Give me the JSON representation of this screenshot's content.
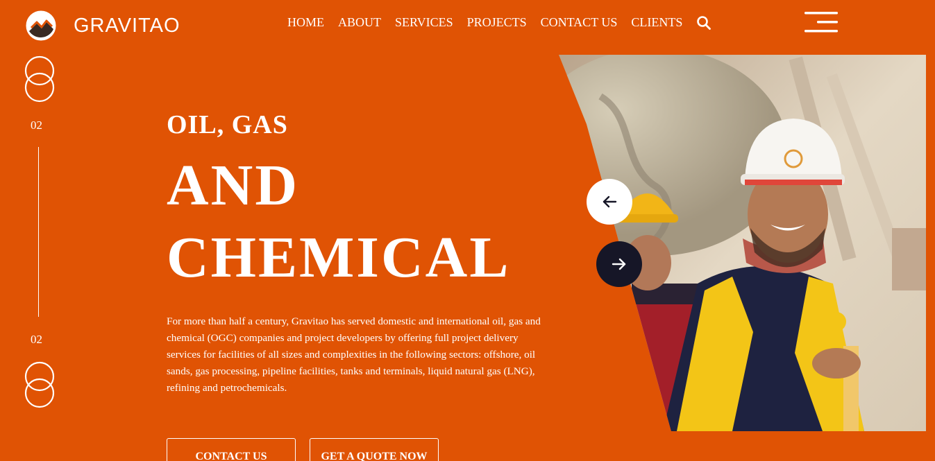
{
  "brand": {
    "name": "GRAVITAO",
    "logo_icon": "mountain-circle-logo-icon"
  },
  "nav": {
    "items": [
      {
        "label": "HOME"
      },
      {
        "label": "ABOUT"
      },
      {
        "label": "SERVICES"
      },
      {
        "label": "PROJECTS"
      },
      {
        "label": "CONTACT US"
      },
      {
        "label": "CLIENTS"
      }
    ],
    "search_icon": "search-icon",
    "menu_icon": "hamburger-menu-icon"
  },
  "slider": {
    "current": "02",
    "total": "02"
  },
  "hero": {
    "kicker": "OIL, GAS",
    "line1": "AND",
    "line2": "CHEMICAL",
    "description": "For more than half a century, Gravitao has served domestic and international oil, gas and chemical (OGC) companies and project developers by offering full project delivery services for facilities of all sizes and complexities in the following sectors: offshore, oil sands, gas processing, pipeline facilities, tanks and terminals, liquid natural gas (LNG), refining and petrochemicals.",
    "buttons": {
      "contact": "CONTACT US",
      "quote": "GET A QUOTE NOW"
    },
    "image_alt_icon": "workers-in-hard-hats-photo",
    "prev_icon": "arrow-left-icon",
    "next_icon": "arrow-right-icon"
  },
  "colors": {
    "background": "#E05304",
    "text": "#FFFFFF",
    "next_button": "#161627",
    "prev_button": "#FFFFFF"
  }
}
